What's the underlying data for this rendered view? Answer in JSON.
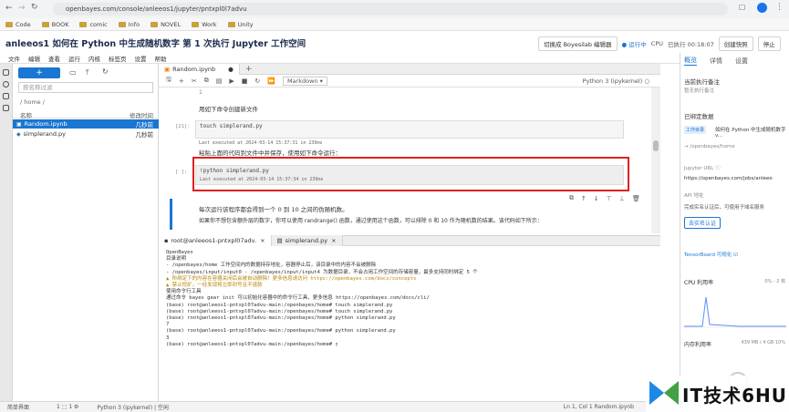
{
  "browser": {
    "url": "openbayes.com/console/anleeos1/jupyter/pntxpl0l7advu",
    "bookmarks": [
      "Code",
      "BOOK",
      "comic",
      "Info",
      "NOVEL",
      "Work",
      "Unity"
    ]
  },
  "app": {
    "title": "anleeos1  如何在 Python 中生成随机数字  第 1 次执行  Jupyter 工作空间",
    "switch_btn": "切换成 Boyesilab 编辑器",
    "status_running": "● 运行中",
    "cpu": "CPU",
    "runtime": "已执行 00:18:07",
    "create_snapshot": "创建快照",
    "stop": "停止"
  },
  "menu": [
    "文件",
    "编辑",
    "查看",
    "运行",
    "内核",
    "标签页",
    "设置",
    "帮助"
  ],
  "file_browser": {
    "filter_placeholder": "按名称过滤",
    "path": "/ home /",
    "col_name": "名称",
    "col_modified": "修改时间",
    "files": [
      {
        "name": "Random.ipynb",
        "modified": "几秒前"
      },
      {
        "name": "simplerand.py",
        "modified": "几秒前"
      }
    ]
  },
  "notebook": {
    "tab_label": "Random.ipynb",
    "cell_type": "Markdown",
    "kernel": "Python 3 (ipykernel) ○",
    "md1": "用如下命令创建新文件",
    "prompt1": "[21]:",
    "code1": "touch simplerand.py",
    "exec1": "Last executed at 2024-03-14 15:37:31 in 239ms",
    "md2": "粘贴上面的代码到文件中并保存，使用如下命令运行：",
    "prompt2": "[  ]:",
    "code2": "!python simplerand.py",
    "exec2": "Last executed at 2024-03-14 15:37:34 in 239ms",
    "line_num": "1",
    "md3": "每次运行该程序都会得到一个 0 到 10 之间的伪随机数。",
    "md4": "如果你不想包含额外层的数字，你可以使用 randrange() 函数，通过使用这个函数，可以排除 0 和 10 作为随机数的结果。该代码如下所示："
  },
  "terminal": {
    "tab1": "root@anleeos1-pntxpl07adv.",
    "tab2": "simplerand.py",
    "lines": [
      "OpenBayes",
      "",
      "目录说明",
      "",
      "- /openbayes/home 工作空间内的数据持存地址，容器停止后，该目录中的内容不会被删除",
      "- /openbayes/input/input0 - /openbayes/input/input4 为数据目录，不会占用工作空间的存储容量，最多支持同时绑定 5 个",
      "",
      "▲ 所绑定下的内容在容器关闭后会被自动删除！更多信息请访问 https://openbayes.com/docs/concepts",
      "▲ 禁止挖矿，一经发现将立即封号且不退款",
      "",
      "使用命令行工具",
      "",
      "通过命令 bayes gear init 可以初始化容器中的命令行工具，更多信息 https://openbayes.com/docs/cli/",
      "",
      "(base) root@anleeos1-pntxpl07advu-main:/openbayes/home# touch simplerand.py",
      "(base) root@anleeos1-pntxpl07advu-main:/openbayes/home# touch simplerand.py",
      "(base) root@anleeos1-pntxpl07advu-main:/openbayes/home# python simplerand.py",
      "7",
      "(base) root@anleeos1-pntxpl07advu-main:/openbayes/home# python simplerand.py",
      "3",
      "(base) root@anleeos1-pntxpl07advu-main:/openbayes/home# ▯"
    ]
  },
  "right_panel": {
    "tabs": [
      "概览",
      "详情",
      "设置"
    ],
    "note_title": "当前执行备注",
    "note_sub": "暂无执行备注",
    "bound_data": "已绑定数据",
    "work_dir_tag": "工作目录",
    "work_dir_name": "如何在 Python 中生成随机数字v...",
    "work_dir_path": "→ /openbayes/home",
    "jupyter_url_label": "Jupyter URL ⓘ",
    "jupyter_url": "https://openbayes.com/jobs/anleeo",
    "api_label": "API 地址",
    "api_hint": "完成实名认证后，可使用子域名服务",
    "verify_btn": "去实名认证",
    "tensorboard": "TensorBoard 可视化 ☑",
    "cpu_label": "CPU 利用率",
    "cpu_value": "0% - 2 核",
    "mem_label": "内存利用率",
    "mem_value": "439 MB / 4 GB 10%"
  },
  "status_bar": {
    "mode": "简单界面",
    "counts": "1  ⬚ 1  ⚙",
    "kernel": "Python 3 (ipykernel) | 空闲",
    "right": "Ln 1, Col 1    Random.ipynb"
  },
  "watermark": "IT技术6HU",
  "colors": {
    "accent": "#1976d2",
    "highlight": "#e02020"
  }
}
